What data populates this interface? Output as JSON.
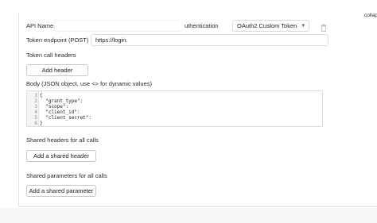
{
  "top_right": {
    "collapse_text": "collap"
  },
  "api": {
    "name_label": "API Name",
    "name_value": "",
    "auth_label": "uthentication",
    "auth_value": "OAuth2 Custom Token"
  },
  "token_endpoint": {
    "label": "Token endpoint (POST)",
    "value": "https://login."
  },
  "token_headers": {
    "label": "Token call headers",
    "add_button": "Add header"
  },
  "body": {
    "label": "Body (JSON object, use <> for dynamic values)",
    "lines": [
      {
        "num": "1",
        "text": "{"
      },
      {
        "num": "2",
        "text": "  \"grant_type\":"
      },
      {
        "num": "3",
        "text": "  \"scope\":"
      },
      {
        "num": "4",
        "text": "  \"client_id\":"
      },
      {
        "num": "5",
        "text": "  \"client_secret\":"
      },
      {
        "num": "6",
        "text": "}"
      }
    ]
  },
  "shared_headers": {
    "label": "Shared headers for all calls",
    "add_button": "Add a shared header"
  },
  "shared_params": {
    "label": "Shared parameters for all calls",
    "add_button": "Add a shared parameter"
  },
  "icons": {
    "dropdown": "chevron-down-icon",
    "delete": "trash-icon"
  },
  "colors": {
    "border": "#dcdcdc",
    "text": "#222222",
    "muted_icon": "#bdbdbd"
  }
}
